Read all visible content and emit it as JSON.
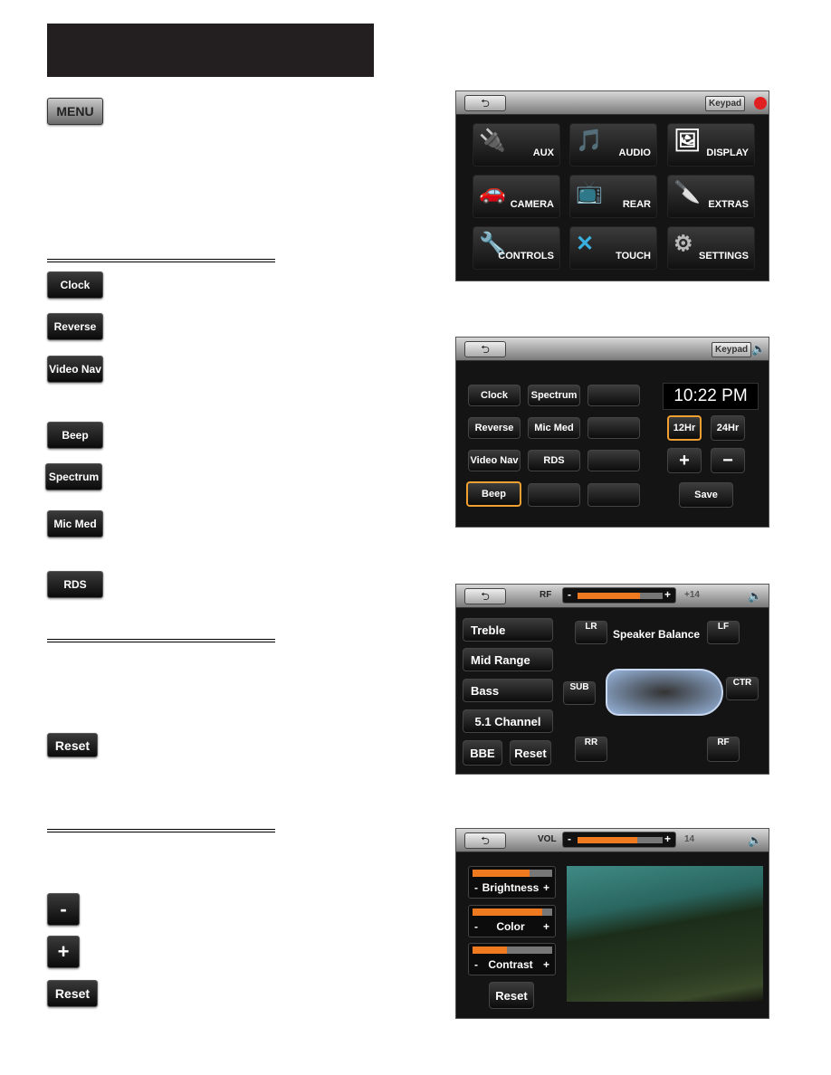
{
  "left": {
    "menu_label": "MENU",
    "buttons": [
      "Clock",
      "Reverse",
      "Video Nav",
      "Beep",
      "Spectrum",
      "Mic Med",
      "RDS"
    ],
    "reset_label": "Reset",
    "minus_label": "-",
    "plus_label": "+",
    "reset2_label": "Reset"
  },
  "screen1": {
    "keypad": "Keypad",
    "tiles": [
      "AUX",
      "AUDIO",
      "DISPLAY",
      "CAMERA",
      "REAR",
      "EXTRAS",
      "CONTROLS",
      "TOUCH",
      "SETTINGS"
    ]
  },
  "screen2": {
    "keypad": "Keypad",
    "grid": [
      "Clock",
      "Spectrum",
      "",
      "Reverse",
      "Mic Med",
      "",
      "Video Nav",
      "RDS",
      "",
      "Beep",
      "",
      ""
    ],
    "time": "10:22 PM",
    "h12": "12Hr",
    "h24": "24Hr",
    "plus": "+",
    "minus": "−",
    "save": "Save"
  },
  "screen3": {
    "label": "RF",
    "value": "+14",
    "level_pct": 73,
    "left_buttons": [
      "Treble",
      "Mid Range",
      "Bass",
      "5.1 Channel"
    ],
    "bbe": "BBE",
    "reset": "Reset",
    "title": "Speaker Balance",
    "speakers": {
      "lr": "LR",
      "lf": "LF",
      "sub": "SUB",
      "ctr": "CTR",
      "rr": "RR",
      "rf": "RF"
    }
  },
  "screen4": {
    "label": "VOL",
    "value": "14",
    "level_pct": 70,
    "adjust": [
      {
        "label": "Brightness",
        "pct": 72
      },
      {
        "label": "Color",
        "pct": 88
      },
      {
        "label": "Contrast",
        "pct": 43
      }
    ],
    "reset": "Reset"
  },
  "colors": {
    "accent": "#f07a20",
    "selected": "#f0a030"
  }
}
